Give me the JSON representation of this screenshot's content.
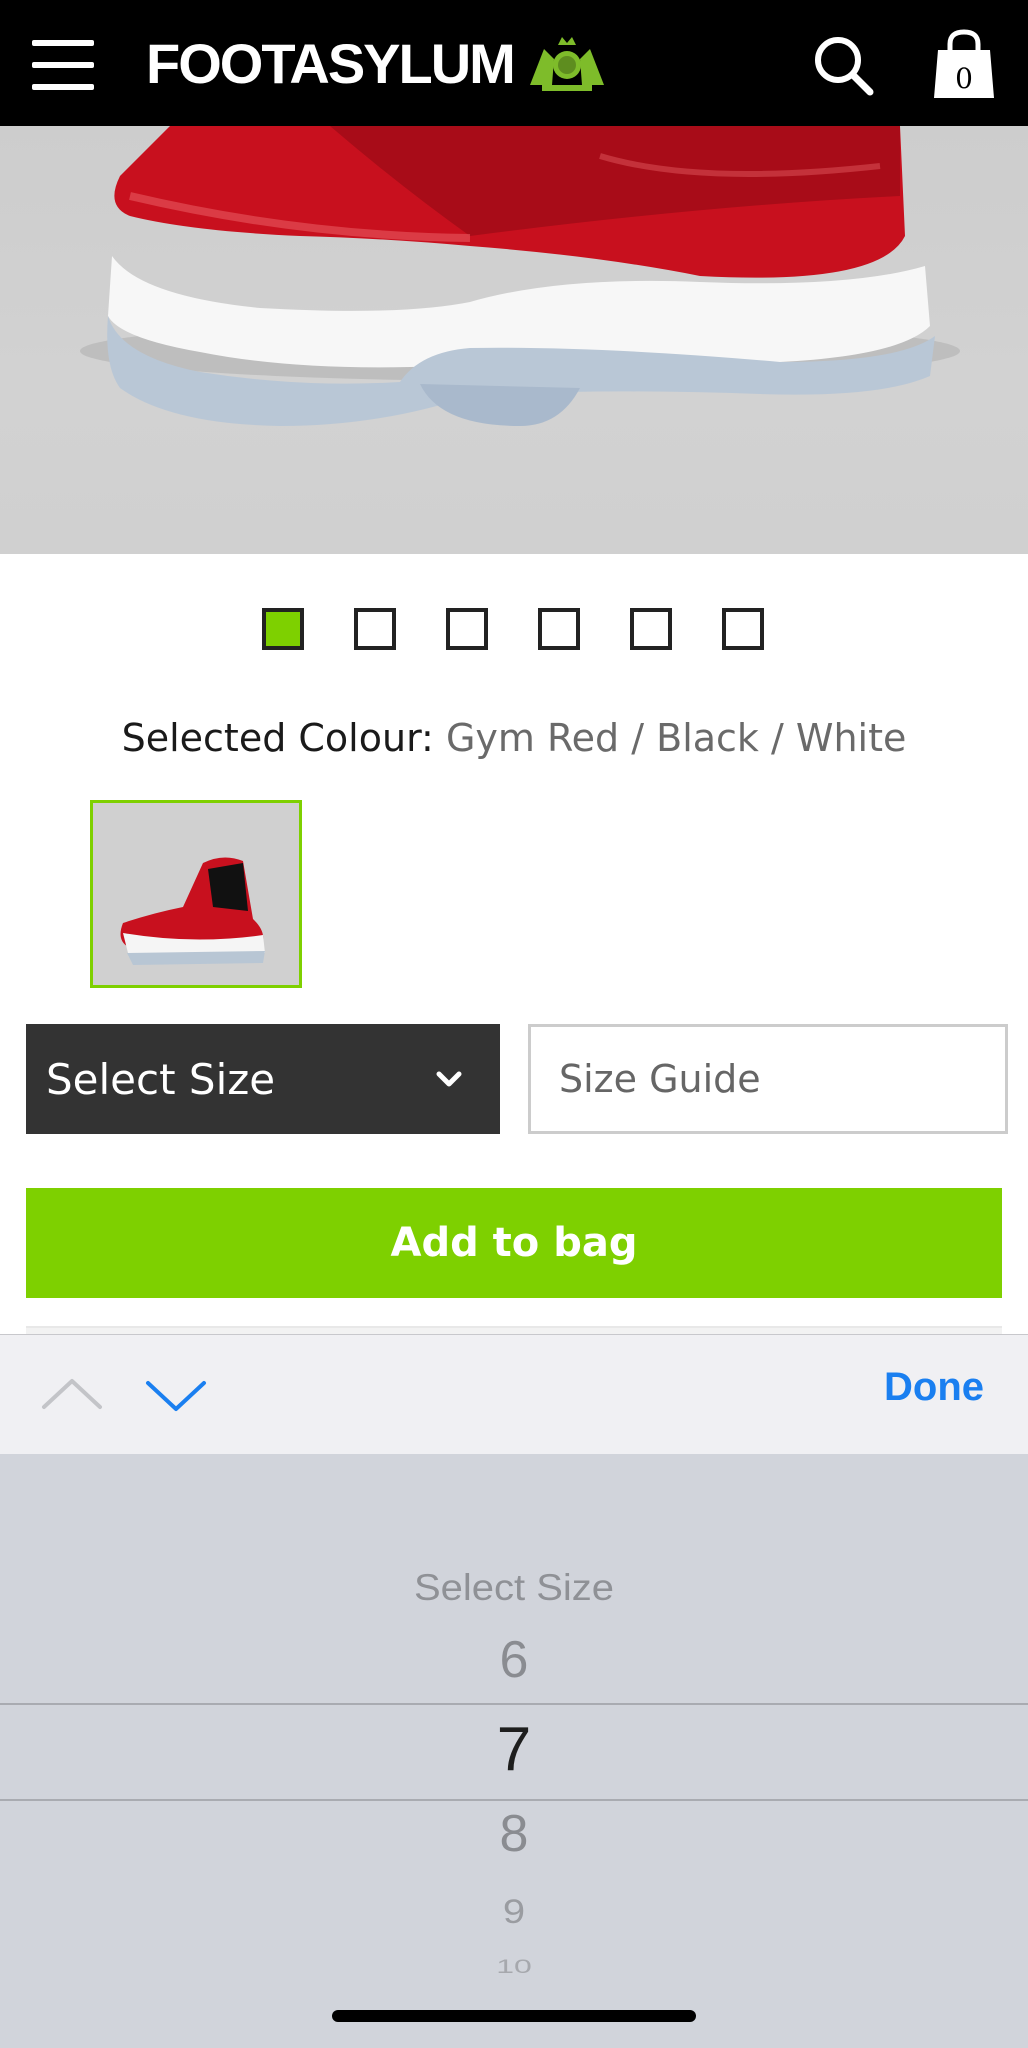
{
  "header": {
    "logo_text": "FOOTASYLUM",
    "bag_count": "0",
    "background": "#000000"
  },
  "product": {
    "image_alt": "Red patent leather basketball sneaker",
    "carousel": {
      "total": 6,
      "active_index": 0
    },
    "colour_label": "Selected Colour:",
    "colour_value": "Gym Red / Black / White"
  },
  "size_select": {
    "label": "Select Size"
  },
  "size_guide": {
    "label": "Size Guide"
  },
  "add_to_bag": {
    "label": "Add to bag",
    "color": "#7ed000"
  },
  "accessory_bar": {
    "done_label": "Done",
    "accent": "#1a7ff0"
  },
  "picker": {
    "options": [
      "Select Size",
      "6",
      "7",
      "8",
      "9",
      "10"
    ],
    "selected": "7"
  }
}
